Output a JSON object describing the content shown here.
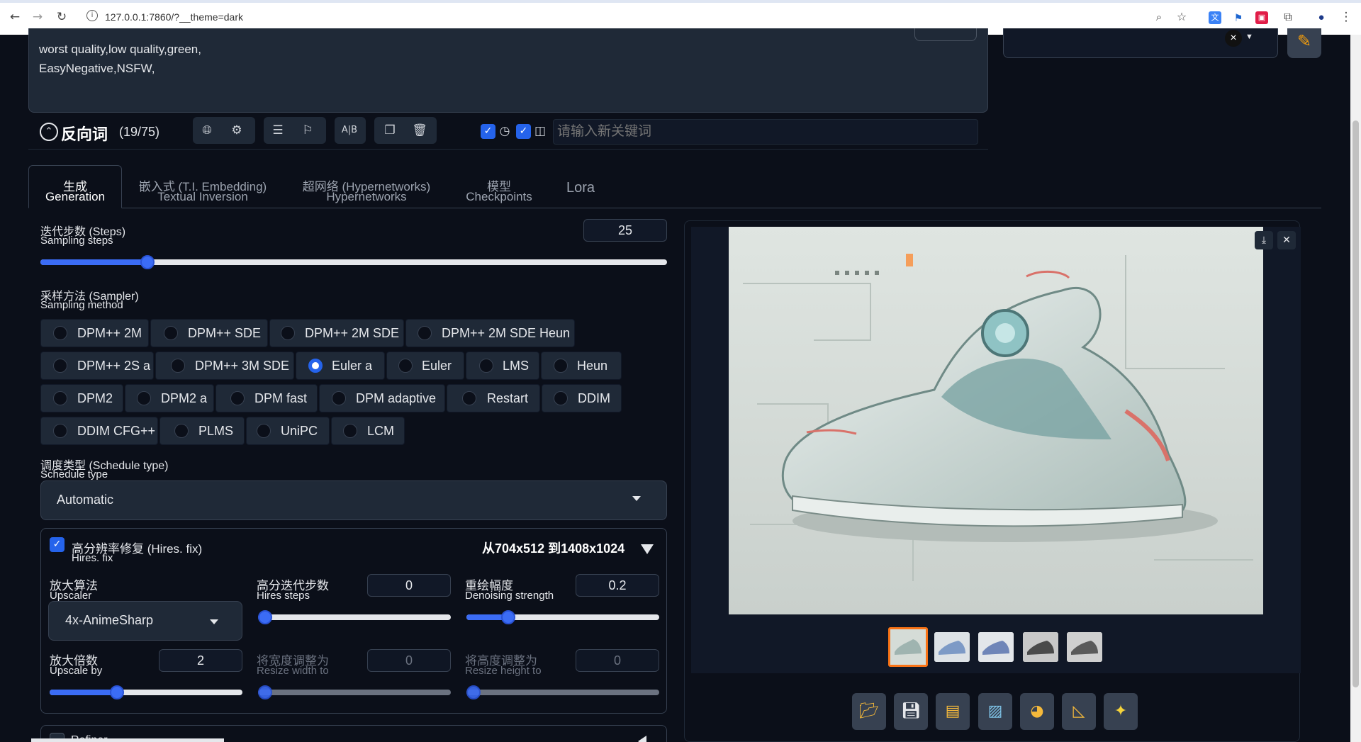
{
  "browser": {
    "url": "127.0.0.1:7860/?__theme=dark"
  },
  "prompt": {
    "negative_lines": [
      "worst quality,low quality,green,",
      "EasyNegative,NSFW,"
    ],
    "negative_title": "反向词",
    "negative_count": "(19/75)",
    "tag_input_placeholder": "请输入新关键词"
  },
  "tabs": [
    {
      "l1": "生成",
      "l2": "Generation"
    },
    {
      "l1": "嵌入式 (T.I. Embedding)",
      "l2": "Textual Inversion"
    },
    {
      "l1": "超网络 (Hypernetworks)",
      "l2": "Hypernetworks"
    },
    {
      "l1": "模型",
      "l2": "Checkpoints"
    },
    {
      "l1": "Lora",
      "l2": ""
    }
  ],
  "steps": {
    "cn": "迭代步数 (Steps)",
    "en": "Sampling steps",
    "value": "25",
    "fraction": 0.163
  },
  "sampler": {
    "cn": "采样方法 (Sampler)",
    "en": "Sampling method",
    "rows": [
      [
        "DPM++ 2M",
        "DPM++ SDE",
        "DPM++ 2M SDE",
        "DPM++ 2M SDE Heun"
      ],
      [
        "DPM++ 2S a",
        "DPM++ 3M SDE",
        "Euler a",
        "Euler",
        "LMS",
        "Heun"
      ],
      [
        "DPM2",
        "DPM2 a",
        "DPM fast",
        "DPM adaptive",
        "Restart",
        "DDIM"
      ],
      [
        "DDIM CFG++",
        "PLMS",
        "UniPC",
        "LCM"
      ]
    ],
    "selected": "Euler a"
  },
  "schedule": {
    "cn": "调度类型 (Schedule type)",
    "en": "Schedule type",
    "value": "Automatic"
  },
  "hires": {
    "cn": "高分辨率修复 (Hires. fix)",
    "en": "Hires. fix",
    "summary": "从704x512 到1408x1024",
    "upscaler_cn": "放大算法",
    "upscaler_en": "Upscaler",
    "upscaler_value": "4x-AnimeSharp",
    "hires_steps_cn": "高分迭代步数",
    "hires_steps_en": "Hires steps",
    "hires_steps_value": "0",
    "denoise_cn": "重绘幅度",
    "denoise_en": "Denoising strength",
    "denoise_value": "0.2",
    "denoise_fraction": 0.2,
    "upscale_by_cn": "放大倍数",
    "upscale_by_en": "Upscale by",
    "upscale_by_value": "2",
    "upscale_by_fraction": 0.35,
    "resize_w_cn": "将宽度调整为",
    "resize_w_en": "Resize width to",
    "resize_w_value": "0",
    "resize_h_cn": "将高度调整为",
    "resize_h_en": "Resize height to",
    "resize_h_value": "0"
  },
  "refiner": {
    "label": "Refiner"
  },
  "icons": {
    "accent": "#3b6cf5",
    "thumb_selected": "#f97316"
  }
}
